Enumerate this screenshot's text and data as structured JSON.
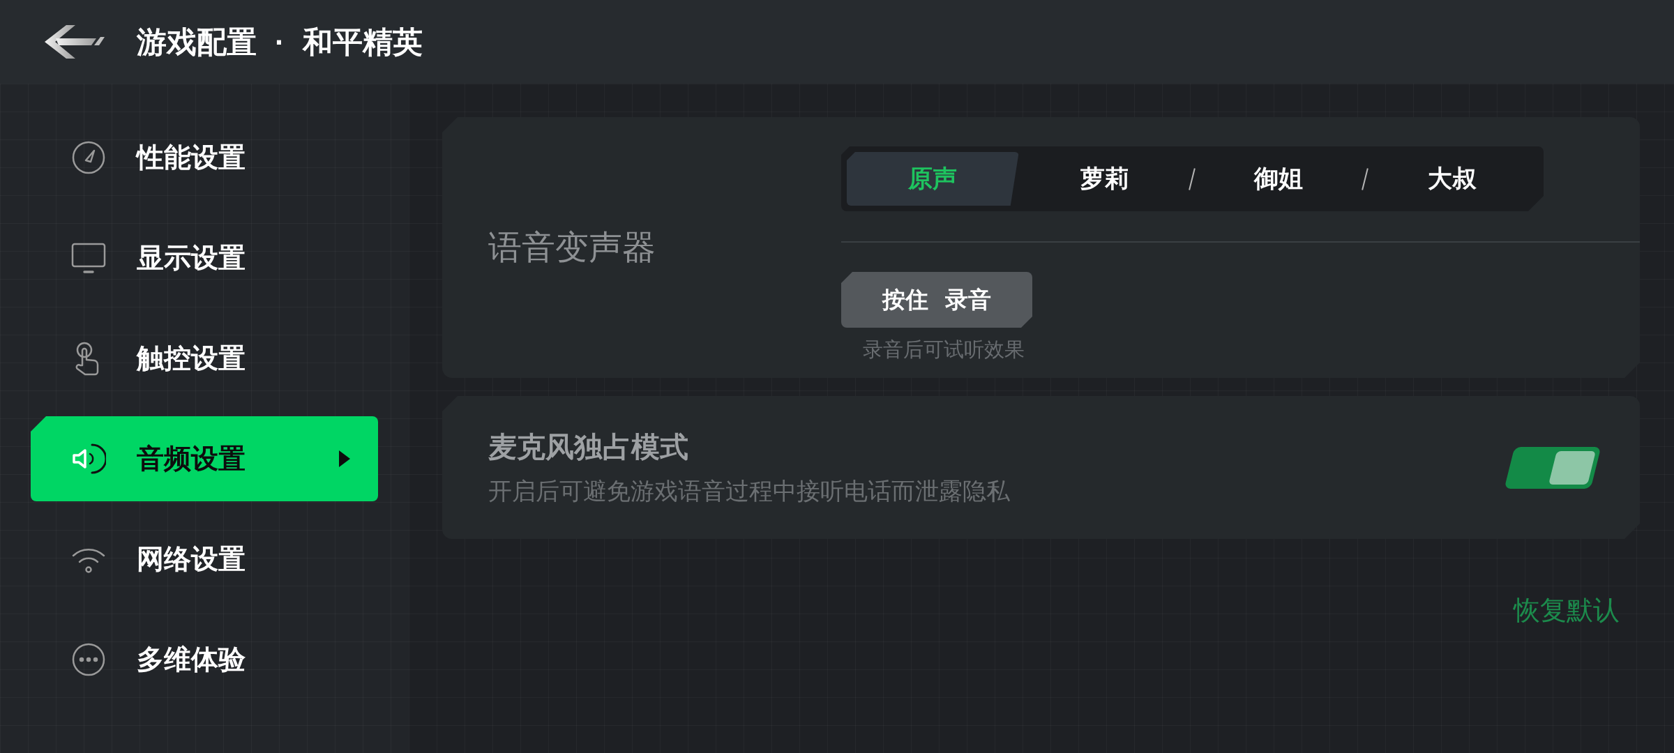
{
  "header": {
    "title": "游戏配置 · 和平精英"
  },
  "sidebar": {
    "items": [
      {
        "label": "性能设置",
        "selected": false
      },
      {
        "label": "显示设置",
        "selected": false
      },
      {
        "label": "触控设置",
        "selected": false
      },
      {
        "label": "音频设置",
        "selected": true
      },
      {
        "label": "网络设置",
        "selected": false
      },
      {
        "label": "多维体验",
        "selected": false
      }
    ]
  },
  "voice_changer": {
    "label": "语音变声器",
    "tabs": [
      {
        "label": "原声",
        "selected": true
      },
      {
        "label": "萝莉",
        "selected": false
      },
      {
        "label": "御姐",
        "selected": false
      },
      {
        "label": "大叔",
        "selected": false
      }
    ],
    "record_button": "按住 录音",
    "hint": "录音后可试听效果"
  },
  "mic_exclusive": {
    "title": "麦克风独占模式",
    "description": "开启后可避免游戏语音过程中接听电话而泄露隐私",
    "on": true
  },
  "restore_button": "恢复默认"
}
